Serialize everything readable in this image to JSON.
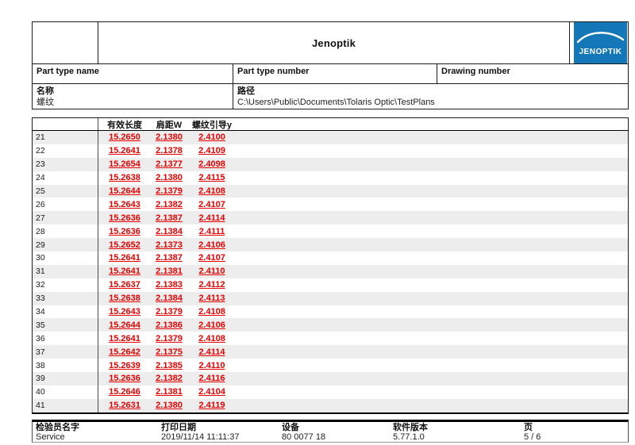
{
  "colors": {
    "accent_red": "#e60000",
    "logo_blue": "#1478b8",
    "row_stripe": "#ededed"
  },
  "header": {
    "title": "Jenoptik",
    "logo_text": "JENOPTIK",
    "part_type_name_label": "Part type name",
    "part_type_number_label": "Part type number",
    "drawing_number_label": "Drawing number",
    "name_label": "名称",
    "name_value": "螺纹",
    "path_label": "路径",
    "path_value": "C:\\Users\\Public\\Documents\\Tolaris Optic\\TestPlans"
  },
  "table": {
    "columns": [
      "有效长度",
      "肩距W",
      "螺纹引导y"
    ],
    "rows": [
      {
        "index": "21",
        "values": [
          "15.2650",
          "2.1380",
          "2.4100"
        ]
      },
      {
        "index": "22",
        "values": [
          "15.2641",
          "2.1378",
          "2.4109"
        ]
      },
      {
        "index": "23",
        "values": [
          "15.2654",
          "2.1377",
          "2.4098"
        ]
      },
      {
        "index": "24",
        "values": [
          "15.2638",
          "2.1380",
          "2.4115"
        ]
      },
      {
        "index": "25",
        "values": [
          "15.2644",
          "2.1379",
          "2.4108"
        ]
      },
      {
        "index": "26",
        "values": [
          "15.2643",
          "2.1382",
          "2.4107"
        ]
      },
      {
        "index": "27",
        "values": [
          "15.2636",
          "2.1387",
          "2.4114"
        ]
      },
      {
        "index": "28",
        "values": [
          "15.2636",
          "2.1384",
          "2.4111"
        ]
      },
      {
        "index": "29",
        "values": [
          "15.2652",
          "2.1373",
          "2.4106"
        ]
      },
      {
        "index": "30",
        "values": [
          "15.2641",
          "2.1387",
          "2.4107"
        ]
      },
      {
        "index": "31",
        "values": [
          "15.2641",
          "2.1381",
          "2.4110"
        ]
      },
      {
        "index": "32",
        "values": [
          "15.2637",
          "2.1383",
          "2.4112"
        ]
      },
      {
        "index": "33",
        "values": [
          "15.2638",
          "2.1384",
          "2.4113"
        ]
      },
      {
        "index": "34",
        "values": [
          "15.2643",
          "2.1379",
          "2.4108"
        ]
      },
      {
        "index": "35",
        "values": [
          "15.2644",
          "2.1386",
          "2.4106"
        ]
      },
      {
        "index": "36",
        "values": [
          "15.2641",
          "2.1379",
          "2.4108"
        ]
      },
      {
        "index": "37",
        "values": [
          "15.2642",
          "2.1375",
          "2.4114"
        ]
      },
      {
        "index": "38",
        "values": [
          "15.2639",
          "2.1385",
          "2.4110"
        ]
      },
      {
        "index": "39",
        "values": [
          "15.2636",
          "2.1382",
          "2.4116"
        ]
      },
      {
        "index": "40",
        "values": [
          "15.2646",
          "2.1381",
          "2.4104"
        ]
      },
      {
        "index": "41",
        "values": [
          "15.2631",
          "2.1380",
          "2.4119"
        ]
      }
    ]
  },
  "footer": {
    "columns": [
      {
        "label": "检验员名字",
        "value": "Service"
      },
      {
        "label": "打印日期",
        "value": "2019/11/14 11:11:37"
      },
      {
        "label": "设备",
        "value": "80 0077 18"
      },
      {
        "label": "软件版本",
        "value": "5.77.1.0"
      },
      {
        "label": "页",
        "value": "5 / 6"
      }
    ]
  }
}
